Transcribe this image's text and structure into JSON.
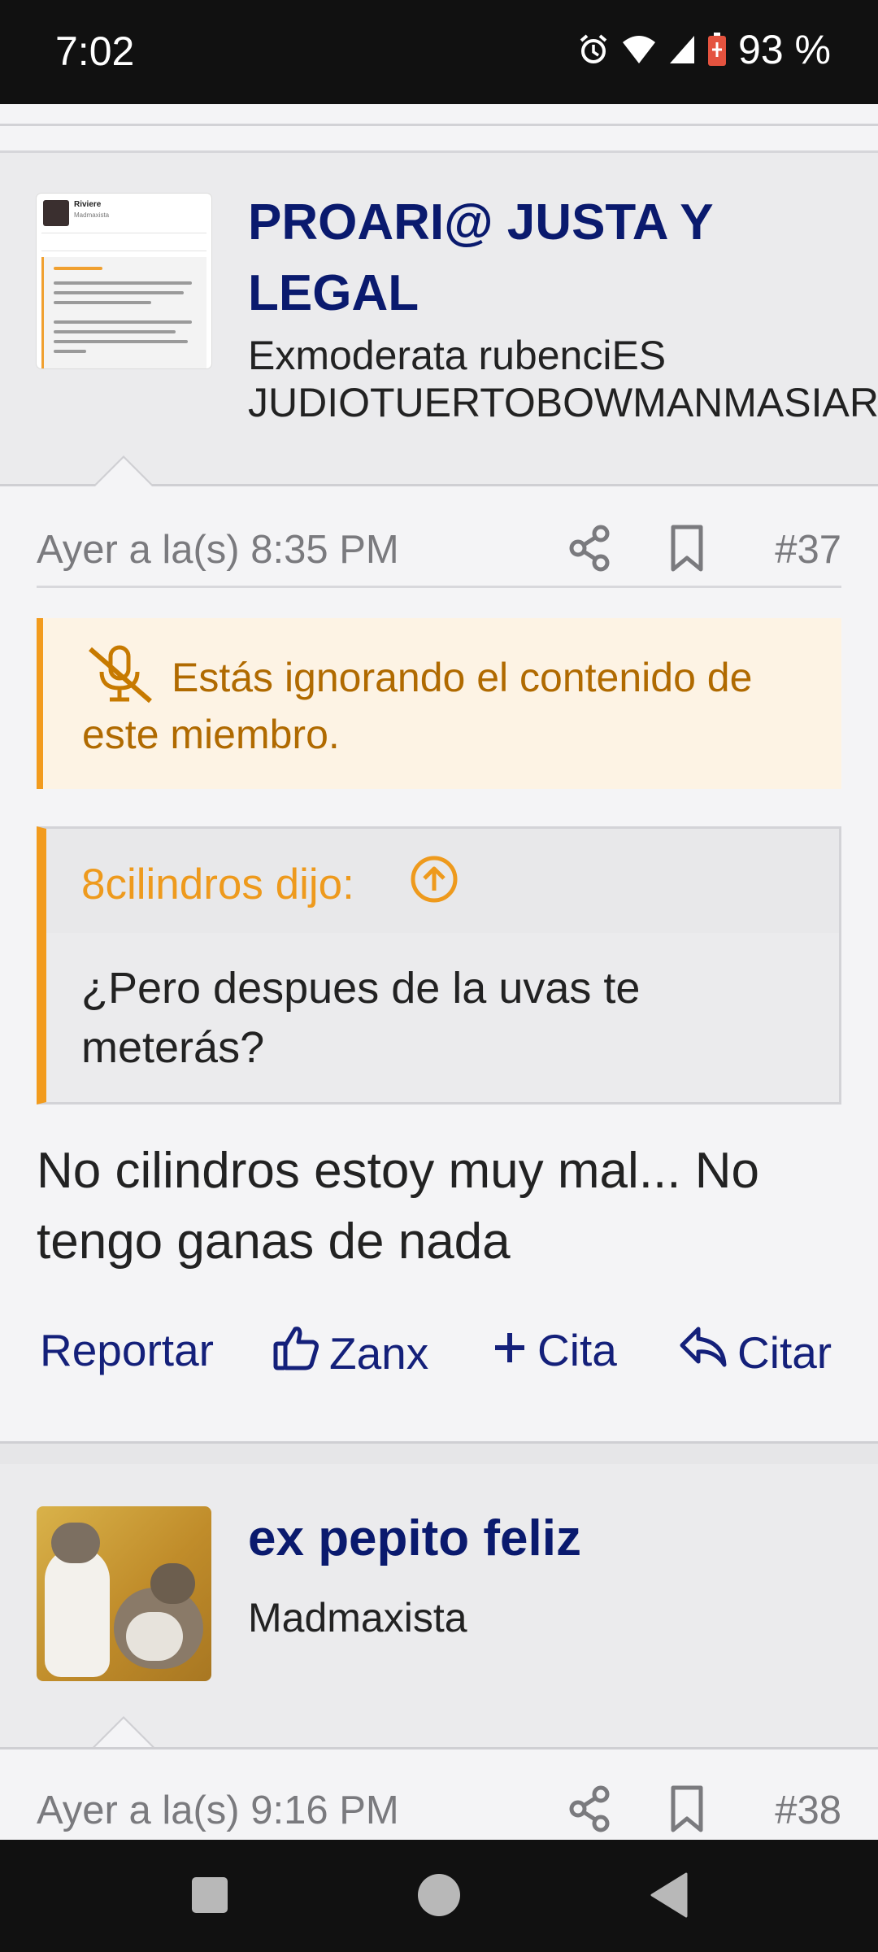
{
  "status_bar": {
    "time": "7:02",
    "battery": "93 %",
    "icons": [
      "alarm-icon",
      "wifi-icon",
      "signal-icon",
      "battery-icon"
    ]
  },
  "posts": [
    {
      "user": {
        "name_line1": "PROARI@ JUSTA Y",
        "name_line2": "LEGAL",
        "title_line1": "Exmoderata rubenciES",
        "title_line2": "JUDIOTUERTOBOWMANMASIAR",
        "avatar_preview": {
          "name": "Riviere",
          "role": "Madmaxista"
        }
      },
      "meta": {
        "date": "Ayer a la(s) 8:35 PM",
        "number": "#37"
      },
      "ignore_notice": "Estás ignorando el contenido de este miembro.",
      "quote": {
        "author": "8cilindros dijo:",
        "text": "¿Pero despues de la uvas te meterás?"
      },
      "body": "No cilindros estoy muy mal... No tengo ganas de nada",
      "actions": {
        "report": "Reportar",
        "like": "Zanx",
        "multiquote": "Cita",
        "reply": "Citar"
      }
    },
    {
      "user": {
        "name": "ex pepito feliz",
        "title": "Madmaxista"
      },
      "meta": {
        "date": "Ayer a la(s) 9:16 PM",
        "number": "#38"
      }
    }
  ],
  "colors": {
    "username": "#0a1a6e",
    "accent_orange": "#f29b1d",
    "link_blue": "#14207a",
    "ignore_text": "#b06a00"
  },
  "nav_bar": [
    "recents-button",
    "home-button",
    "back-button"
  ]
}
